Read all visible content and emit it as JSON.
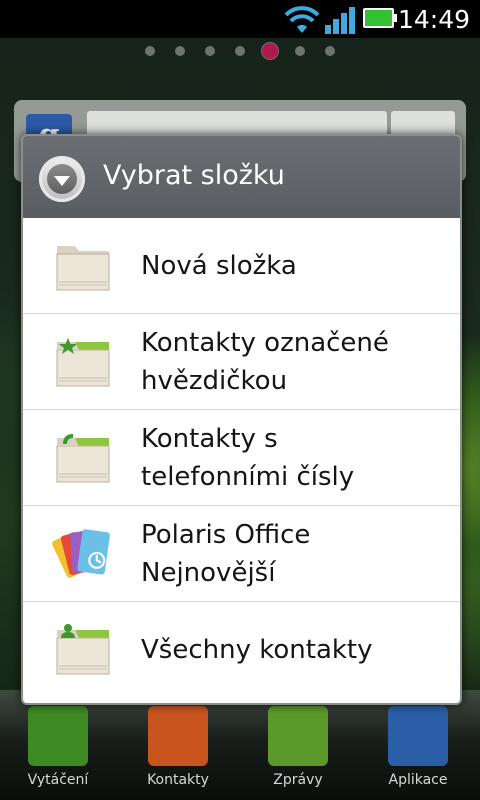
{
  "status_bar": {
    "time": "14:49",
    "icons": [
      "wifi-icon",
      "signal-icon",
      "battery-icon"
    ]
  },
  "home": {
    "page_count": 7,
    "active_page": 5,
    "search_widget_icon": "google-icon",
    "google_glyph": "g"
  },
  "dialog": {
    "title": "Vybrat složku",
    "header_icon": "dropdown-circle-icon",
    "items": [
      {
        "label": "Nová složka",
        "icon": "folder-icon"
      },
      {
        "label": "Kontakty označené\nhvězdičkou",
        "icon": "starred-folder-icon"
      },
      {
        "label": "Kontakty s\ntelefonními čísly",
        "icon": "phone-folder-icon"
      },
      {
        "label": "Polaris Office\nNejnovější",
        "icon": "polaris-office-icon"
      },
      {
        "label": "Všechny kontakty",
        "icon": "contacts-folder-icon"
      }
    ]
  },
  "dock": {
    "apps": [
      {
        "label": "Vytáčení",
        "icon": "phone-icon",
        "color": "#3d8a22"
      },
      {
        "label": "Kontakty",
        "icon": "contacts-icon",
        "color": "#c9541e"
      },
      {
        "label": "Zprávy",
        "icon": "messages-icon",
        "color": "#5b9a2a"
      },
      {
        "label": "Aplikace",
        "icon": "apps-grid-icon",
        "color": "#2a5fa8"
      }
    ]
  },
  "colors": {
    "folder_tab_green": "#8cc63f",
    "dialog_header": "#5f6368",
    "active_dot": "#b01850"
  }
}
